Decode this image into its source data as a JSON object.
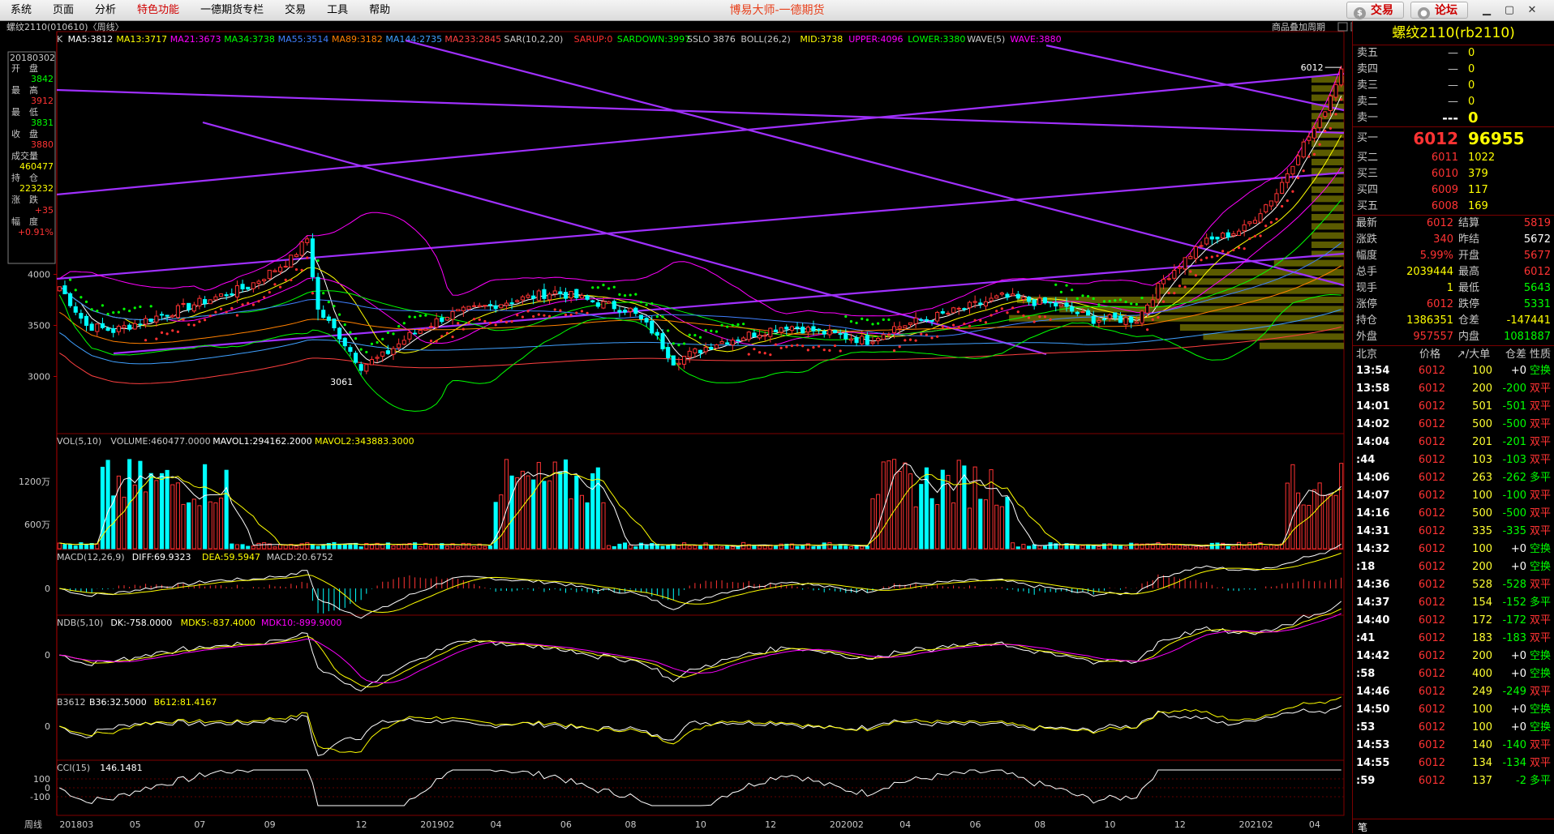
{
  "menubar": {
    "items": [
      "系统",
      "页面",
      "分析",
      "特色功能",
      "一德期货专栏",
      "交易",
      "工具",
      "帮助"
    ],
    "active_index": 3,
    "app_title": "博易大师-一德期货",
    "trade_btn": "交易",
    "forum_btn": "论坛"
  },
  "chart": {
    "title": "螺纹2110(010610)〈周线〉",
    "overlay_btn": "商品叠加",
    "period_btn": "周期",
    "k_indicators": [
      {
        "t": "K",
        "c": "#c8c8c8"
      },
      {
        "t": "MA5:3812",
        "c": "#ffffff"
      },
      {
        "t": "MA13:3717",
        "c": "#ffff00"
      },
      {
        "t": "MA21:3673",
        "c": "#ff00ff"
      },
      {
        "t": "MA34:3738",
        "c": "#00ff00"
      },
      {
        "t": "MA55:3514",
        "c": "#4080ff"
      },
      {
        "t": "MA89:3182",
        "c": "#ff8000"
      },
      {
        "t": "MA144:2735",
        "c": "#3fa0ff"
      },
      {
        "t": "MA233:2845",
        "c": "#ff4040"
      },
      {
        "t": "SAR(10,2,20)",
        "c": "#c8c8c8"
      },
      {
        "t": "SARUP:0",
        "c": "#ff3030"
      },
      {
        "t": "SARDOWN:3997",
        "c": "#00ff00"
      },
      {
        "t": "SSLO 3876",
        "c": "#c8c8c8"
      },
      {
        "t": "BOLL(26,2)",
        "c": "#c8c8c8"
      },
      {
        "t": "MID:3738",
        "c": "#ffff00"
      },
      {
        "t": "UPPER:4096",
        "c": "#ff00ff"
      },
      {
        "t": "LOWER:3380",
        "c": "#00ff00"
      },
      {
        "t": "WAVE(5)",
        "c": "#c8c8c8"
      },
      {
        "t": "WAVE:3880",
        "c": "#ff00ff"
      }
    ],
    "info_box": {
      "date": "20180302",
      "open_label": "开　盘",
      "open": "3842",
      "high_label": "最　高",
      "high": "3912",
      "low_label": "最　低",
      "low": "3831",
      "close_label": "收　盘",
      "close": "3880",
      "vol_label": "成交量",
      "vol": "460477",
      "oi_label": "持　仓",
      "oi": "223232",
      "chg_label": "涨　跌",
      "chg": "+35",
      "pct_label": "幅　度",
      "pct": "+0.91%"
    },
    "price_axis": [
      "4000",
      "3500",
      "3000"
    ],
    "high_label": "6012",
    "low_label": "3061",
    "vol_header": [
      {
        "t": "VOL(5,10)",
        "c": "#c8c8c8"
      },
      {
        "t": "VOLUME:460477.0000",
        "c": "#c8c8c8"
      },
      {
        "t": "MAVOL1:294162.2000",
        "c": "#ffffff"
      },
      {
        "t": "MAVOL2:343883.3000",
        "c": "#ffff00"
      }
    ],
    "vol_axis": [
      "1200万",
      "600万"
    ],
    "macd_header": [
      {
        "t": "MACD(12,26,9)",
        "c": "#c8c8c8"
      },
      {
        "t": "DIFF:69.9323",
        "c": "#ffffff"
      },
      {
        "t": "DEA:59.5947",
        "c": "#ffff00"
      },
      {
        "t": "MACD:20.6752",
        "c": "#c8c8c8"
      }
    ],
    "ndb_header": [
      {
        "t": "NDB(5,10)",
        "c": "#c8c8c8"
      },
      {
        "t": "DK:-758.0000",
        "c": "#ffffff"
      },
      {
        "t": "MDK5:-837.4000",
        "c": "#ffff00"
      },
      {
        "t": "MDK10:-899.9000",
        "c": "#ff00ff"
      }
    ],
    "b36_header": [
      {
        "t": "B3612",
        "c": "#c8c8c8"
      },
      {
        "t": "B36:32.5000",
        "c": "#ffffff"
      },
      {
        "t": "B612:81.4167",
        "c": "#ffff00"
      }
    ],
    "cci_header": [
      {
        "t": "CCI(15)",
        "c": "#c8c8c8"
      },
      {
        "t": "146.1481",
        "c": "#ffffff"
      }
    ],
    "zero": "0",
    "cci_axis": [
      "100",
      "0",
      "-100"
    ],
    "period_label": "周线",
    "x_axis": [
      "201803",
      "05",
      "07",
      "09",
      "12",
      "201902",
      "04",
      "06",
      "08",
      "10",
      "12",
      "202002",
      "04",
      "06",
      "08",
      "10",
      "12",
      "202102",
      "04"
    ]
  },
  "panel": {
    "title": "螺纹2110(rb2110)",
    "asks": [
      {
        "label": "卖五",
        "price": "—",
        "qty": "0"
      },
      {
        "label": "卖四",
        "price": "—",
        "qty": "0"
      },
      {
        "label": "卖三",
        "price": "—",
        "qty": "0"
      },
      {
        "label": "卖二",
        "price": "—",
        "qty": "0"
      },
      {
        "label": "卖一",
        "price": "---",
        "qty": "0"
      }
    ],
    "bids": [
      {
        "label": "买一",
        "price": "6012",
        "qty": "96955"
      },
      {
        "label": "买二",
        "price": "6011",
        "qty": "1022"
      },
      {
        "label": "买三",
        "price": "6010",
        "qty": "379"
      },
      {
        "label": "买四",
        "price": "6009",
        "qty": "117"
      },
      {
        "label": "买五",
        "price": "6008",
        "qty": "169"
      }
    ],
    "stats": [
      {
        "l1": "最新",
        "v1": "6012",
        "c1": "pos",
        "l2": "结算",
        "v2": "5819",
        "c2": "pos"
      },
      {
        "l1": "涨跌",
        "v1": "340",
        "c1": "pos",
        "l2": "昨结",
        "v2": "5672",
        "c2": "wht"
      },
      {
        "l1": "幅度",
        "v1": "5.99%",
        "c1": "pos",
        "l2": "开盘",
        "v2": "5677",
        "c2": "pos"
      },
      {
        "l1": "总手",
        "v1": "2039444",
        "c1": "yel",
        "l2": "最高",
        "v2": "6012",
        "c2": "pos"
      },
      {
        "l1": "现手",
        "v1": "1",
        "c1": "yel",
        "l2": "最低",
        "v2": "5643",
        "c2": "neg"
      },
      {
        "l1": "涨停",
        "v1": "6012",
        "c1": "pos",
        "l2": "跌停",
        "v2": "5331",
        "c2": "neg"
      },
      {
        "l1": "持仓",
        "v1": "1386351",
        "c1": "yel",
        "l2": "仓差",
        "v2": "-147441",
        "c2": "yel"
      },
      {
        "l1": "外盘",
        "v1": "957557",
        "c1": "pos",
        "l2": "内盘",
        "v2": "1081887",
        "c2": "neg"
      }
    ],
    "ticks_header": {
      "time": "北京",
      "price": "价格",
      "vol": "↗/大单",
      "oi": "仓差",
      "nature": "性质"
    },
    "ticks": [
      {
        "t": "13:54",
        "p": "6012",
        "v": "100",
        "o": "+0",
        "n": "空换"
      },
      {
        "t": "13:58",
        "p": "6012",
        "v": "200",
        "o": "-200",
        "n": "双平"
      },
      {
        "t": "14:01",
        "p": "6012",
        "v": "501",
        "o": "-501",
        "n": "双平"
      },
      {
        "t": "14:02",
        "p": "6012",
        "v": "500",
        "o": "-500",
        "n": "双平"
      },
      {
        "t": "14:04",
        "p": "6012",
        "v": "201",
        "o": "-201",
        "n": "双平"
      },
      {
        "t": ":44",
        "p": "6012",
        "v": "103",
        "o": "-103",
        "n": "双平"
      },
      {
        "t": "14:06",
        "p": "6012",
        "v": "263",
        "o": "-262",
        "n": "多平"
      },
      {
        "t": "14:07",
        "p": "6012",
        "v": "100",
        "o": "-100",
        "n": "双平"
      },
      {
        "t": "14:16",
        "p": "6012",
        "v": "500",
        "o": "-500",
        "n": "双平"
      },
      {
        "t": "14:31",
        "p": "6012",
        "v": "335",
        "o": "-335",
        "n": "双平"
      },
      {
        "t": "14:32",
        "p": "6012",
        "v": "100",
        "o": "+0",
        "n": "空换"
      },
      {
        "t": ":18",
        "p": "6012",
        "v": "200",
        "o": "+0",
        "n": "空换"
      },
      {
        "t": "14:36",
        "p": "6012",
        "v": "528",
        "o": "-528",
        "n": "双平"
      },
      {
        "t": "14:37",
        "p": "6012",
        "v": "154",
        "o": "-152",
        "n": "多平"
      },
      {
        "t": "14:40",
        "p": "6012",
        "v": "172",
        "o": "-172",
        "n": "双平"
      },
      {
        "t": ":41",
        "p": "6012",
        "v": "183",
        "o": "-183",
        "n": "双平"
      },
      {
        "t": "14:42",
        "p": "6012",
        "v": "200",
        "o": "+0",
        "n": "空换"
      },
      {
        "t": ":58",
        "p": "6012",
        "v": "400",
        "o": "+0",
        "n": "空换"
      },
      {
        "t": "14:46",
        "p": "6012",
        "v": "249",
        "o": "-249",
        "n": "双平"
      },
      {
        "t": "14:50",
        "p": "6012",
        "v": "100",
        "o": "+0",
        "n": "空换"
      },
      {
        "t": ":53",
        "p": "6012",
        "v": "100",
        "o": "+0",
        "n": "空换"
      },
      {
        "t": "14:53",
        "p": "6012",
        "v": "140",
        "o": "-140",
        "n": "双平"
      },
      {
        "t": "14:55",
        "p": "6012",
        "v": "134",
        "o": "-134",
        "n": "双平"
      },
      {
        "t": ":59",
        "p": "6012",
        "v": "137",
        "o": "-2",
        "n": "多平"
      }
    ],
    "bottom_tab": "笔"
  },
  "chart_data": {
    "type": "candlestick",
    "price_range": [
      2750,
      6100
    ],
    "anchors": [
      {
        "i": 0,
        "c": 3880
      },
      {
        "i": 5,
        "c": 3500
      },
      {
        "i": 10,
        "c": 3450
      },
      {
        "i": 20,
        "c": 3620
      },
      {
        "i": 35,
        "c": 3880
      },
      {
        "i": 40,
        "c": 4050
      },
      {
        "i": 43,
        "c": 4150
      },
      {
        "i": 46,
        "c": 4350
      },
      {
        "i": 48,
        "c": 3650
      },
      {
        "i": 52,
        "c": 3400
      },
      {
        "i": 56,
        "c": 3100
      },
      {
        "i": 60,
        "c": 3200
      },
      {
        "i": 65,
        "c": 3400
      },
      {
        "i": 72,
        "c": 3600
      },
      {
        "i": 82,
        "c": 3720
      },
      {
        "i": 92,
        "c": 3830
      },
      {
        "i": 100,
        "c": 3720
      },
      {
        "i": 106,
        "c": 3650
      },
      {
        "i": 110,
        "c": 3450
      },
      {
        "i": 114,
        "c": 3150
      },
      {
        "i": 122,
        "c": 3330
      },
      {
        "i": 135,
        "c": 3500
      },
      {
        "i": 150,
        "c": 3350
      },
      {
        "i": 155,
        "c": 3480
      },
      {
        "i": 165,
        "c": 3620
      },
      {
        "i": 175,
        "c": 3780
      },
      {
        "i": 185,
        "c": 3700
      },
      {
        "i": 192,
        "c": 3560
      },
      {
        "i": 200,
        "c": 3560
      },
      {
        "i": 205,
        "c": 3950
      },
      {
        "i": 212,
        "c": 4300
      },
      {
        "i": 220,
        "c": 4450
      },
      {
        "i": 226,
        "c": 4800
      },
      {
        "i": 230,
        "c": 5200
      },
      {
        "i": 234,
        "c": 5500
      },
      {
        "i": 238,
        "c": 6012
      }
    ],
    "volume_hot_ranges": [
      [
        8,
        31
      ],
      [
        81,
        101
      ],
      [
        151,
        176
      ],
      [
        228,
        238
      ]
    ],
    "last_close": 6012,
    "period_high": 6012,
    "period_low": 3061
  }
}
